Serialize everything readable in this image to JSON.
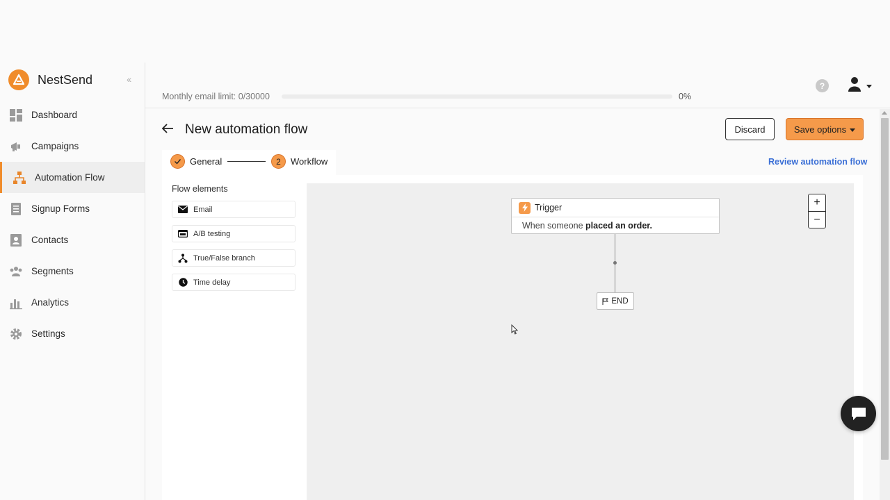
{
  "brand": {
    "name": "NestSend",
    "accent": "#f08c2b"
  },
  "sidebar": {
    "items": [
      {
        "label": "Dashboard",
        "icon": "dashboard-icon"
      },
      {
        "label": "Campaigns",
        "icon": "megaphone-icon"
      },
      {
        "label": "Automation Flow",
        "icon": "flow-icon",
        "active": true
      },
      {
        "label": "Signup Forms",
        "icon": "form-icon"
      },
      {
        "label": "Contacts",
        "icon": "contacts-icon"
      },
      {
        "label": "Segments",
        "icon": "segments-icon"
      },
      {
        "label": "Analytics",
        "icon": "analytics-icon"
      },
      {
        "label": "Settings",
        "icon": "gear-icon"
      }
    ]
  },
  "topbar": {
    "limit_label": "Monthly email limit: 0/30000",
    "limit_percent": "0%",
    "limit_progress": 0,
    "help_glyph": "?"
  },
  "header": {
    "title": "New automation flow",
    "discard_label": "Discard",
    "save_label": "Save options"
  },
  "stepper": {
    "step1_label": "General",
    "step2_number": "2",
    "step2_label": "Workflow",
    "review_link": "Review automation flow"
  },
  "flow_elements": {
    "title": "Flow elements",
    "items": [
      {
        "label": "Email",
        "icon": "envelope-icon"
      },
      {
        "label": "A/B testing",
        "icon": "ab-test-icon"
      },
      {
        "label": "True/False branch",
        "icon": "branch-icon"
      },
      {
        "label": "Time delay",
        "icon": "clock-icon"
      }
    ]
  },
  "canvas": {
    "trigger_title": "Trigger",
    "trigger_prefix": "When someone",
    "trigger_event": "placed an order.",
    "end_label": "END",
    "zoom_in": "+",
    "zoom_out": "−"
  }
}
